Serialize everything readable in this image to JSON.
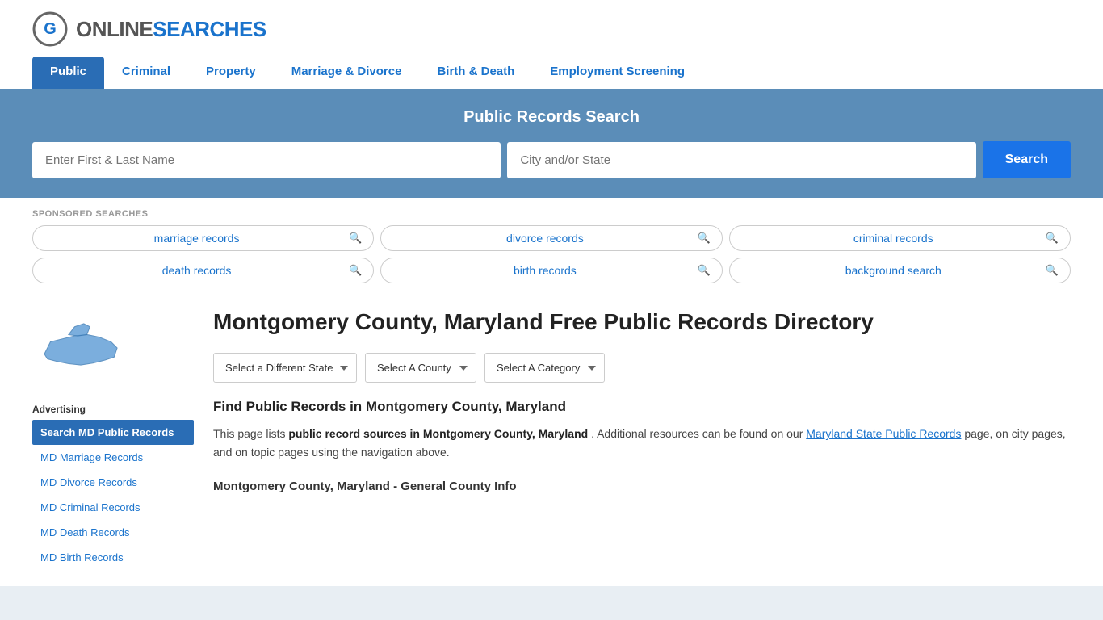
{
  "logo": {
    "online": "ONLINE",
    "searches": "SEARCHES"
  },
  "nav": {
    "items": [
      {
        "label": "Public",
        "active": true
      },
      {
        "label": "Criminal",
        "active": false
      },
      {
        "label": "Property",
        "active": false
      },
      {
        "label": "Marriage & Divorce",
        "active": false
      },
      {
        "label": "Birth & Death",
        "active": false
      },
      {
        "label": "Employment Screening",
        "active": false
      }
    ]
  },
  "search_banner": {
    "title": "Public Records Search",
    "name_placeholder": "Enter First & Last Name",
    "location_placeholder": "City and/or State",
    "button_label": "Search"
  },
  "sponsored": {
    "label": "SPONSORED SEARCHES",
    "pills": [
      {
        "text": "marriage records"
      },
      {
        "text": "divorce records"
      },
      {
        "text": "criminal records"
      },
      {
        "text": "death records"
      },
      {
        "text": "birth records"
      },
      {
        "text": "background search"
      }
    ]
  },
  "page_title": "Montgomery County, Maryland Free Public Records Directory",
  "filters": {
    "state_label": "Select a Different State",
    "county_label": "Select A County",
    "category_label": "Select A Category"
  },
  "find_records_heading": "Find Public Records in Montgomery County, Maryland",
  "intro_paragraph": "This page lists",
  "intro_bold": "public record sources in Montgomery County, Maryland",
  "intro_end": ". Additional resources can be found on our",
  "state_link": "Maryland State Public Records",
  "intro_end2": "page, on city pages, and on topic pages using the navigation above.",
  "sidebar": {
    "advertising_label": "Advertising",
    "ad_items": [
      {
        "label": "Search MD Public Records",
        "active": true
      },
      {
        "label": "MD Marriage Records",
        "active": false
      },
      {
        "label": "MD Divorce Records",
        "active": false
      },
      {
        "label": "MD Criminal Records",
        "active": false
      },
      {
        "label": "MD Death Records",
        "active": false
      },
      {
        "label": "MD Birth Records",
        "active": false
      }
    ]
  },
  "county_info_heading": "Montgomery County, Maryland - General County Info"
}
